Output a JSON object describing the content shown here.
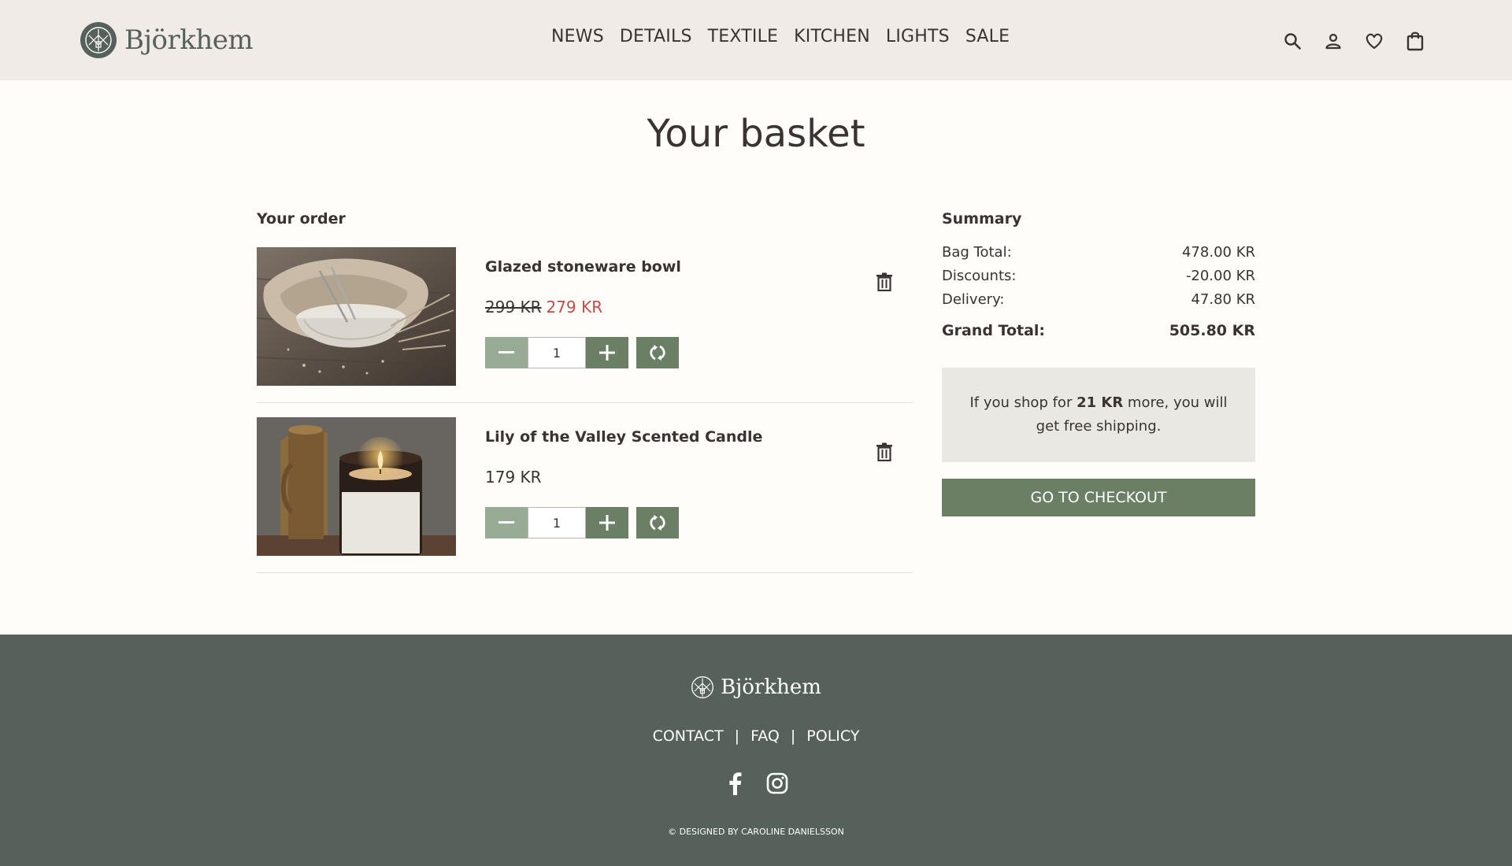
{
  "brand": {
    "name": "Björkhem"
  },
  "nav": {
    "items": [
      "NEWS",
      "DETAILS",
      "TEXTILE",
      "KITCHEN",
      "LIGHTS",
      "SALE"
    ]
  },
  "header_icons": [
    "search-icon",
    "user-icon",
    "heart-icon",
    "bag-icon"
  ],
  "page": {
    "title": "Your basket"
  },
  "order": {
    "heading": "Your order",
    "items": [
      {
        "name": "Glazed stoneware bowl",
        "old_price": "299 KR",
        "price": "279 KR",
        "quantity": "1"
      },
      {
        "name": "Lily of the Valley Scented Candle",
        "price": "179 KR",
        "quantity": "1"
      }
    ]
  },
  "summary": {
    "heading": "Summary",
    "rows": [
      {
        "label": "Bag Total:",
        "value": "478.00 KR"
      },
      {
        "label": "Discounts:",
        "value": "-20.00 KR"
      },
      {
        "label": "Delivery:",
        "value": "47.80 KR"
      }
    ],
    "total": {
      "label": "Grand Total:",
      "value": "505.80 KR"
    },
    "notice": {
      "prefix": "If you shop for ",
      "amount": "21 KR",
      "suffix": " more, you will get free shipping."
    },
    "checkout_label": "GO TO CHECKOUT"
  },
  "footer": {
    "brand": "Björkhem",
    "links": [
      "CONTACT",
      "FAQ",
      "POLICY"
    ],
    "separator": "|",
    "copyright": "© DESIGNED BY CAROLINE DANIELSSON"
  },
  "colors": {
    "accent": "#6a7f64",
    "accent_light": "#98ab94",
    "sale": "#c24b4b",
    "footer": "#56615b",
    "header": "#f0ebe7"
  }
}
